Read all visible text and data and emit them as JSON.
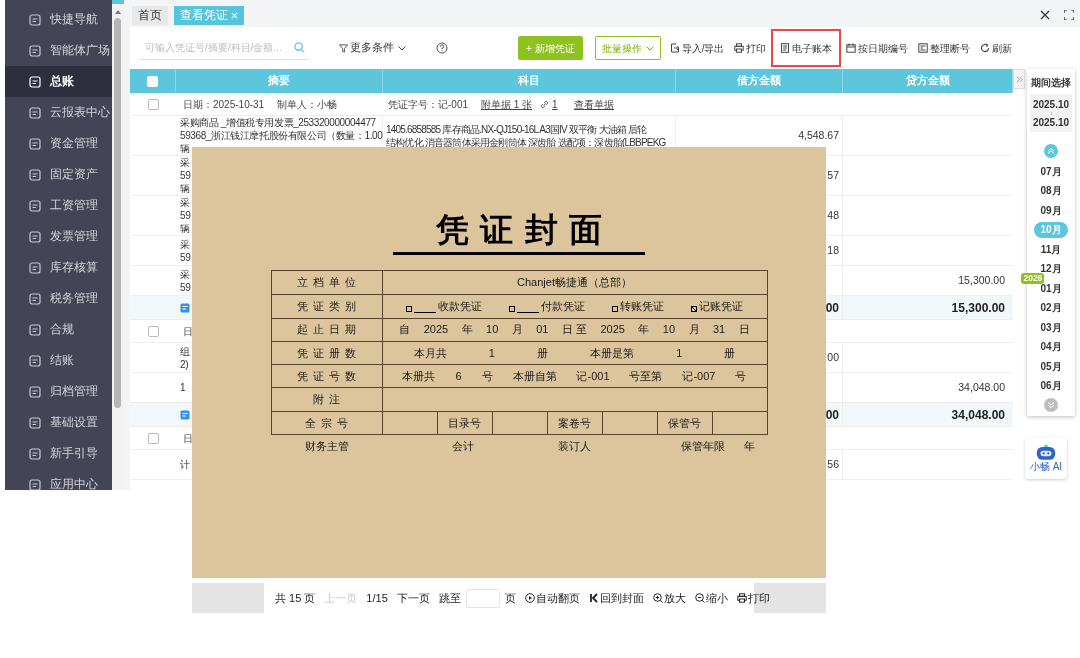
{
  "sidebar": {
    "items": [
      {
        "label": "快捷导航",
        "selected": false
      },
      {
        "label": "智能体广场",
        "selected": false
      },
      {
        "label": "总账",
        "selected": true
      },
      {
        "label": "云报表中心",
        "selected": false
      },
      {
        "label": "资金管理",
        "selected": false
      },
      {
        "label": "固定资产",
        "selected": false
      },
      {
        "label": "工资管理",
        "selected": false
      },
      {
        "label": "发票管理",
        "selected": false
      },
      {
        "label": "库存核算",
        "selected": false
      },
      {
        "label": "税务管理",
        "selected": false
      },
      {
        "label": "合规",
        "selected": false
      },
      {
        "label": "结账",
        "selected": false
      },
      {
        "label": "归档管理",
        "selected": false
      },
      {
        "label": "基础设置",
        "selected": false
      },
      {
        "label": "新手引导",
        "selected": false
      },
      {
        "label": "应用中心",
        "selected": false
      }
    ]
  },
  "tabs": [
    {
      "label": "首页",
      "selected": false,
      "closable": false
    },
    {
      "label": "查看凭证",
      "selected": true,
      "closable": true
    }
  ],
  "toolbar": {
    "search": {
      "placeholder": "可输入凭证号/摘要/科目/金额..."
    },
    "filter_label": "更多条件",
    "new_button": "+ 新增凭证",
    "batch_button": "批量操作",
    "actions": [
      {
        "kind": "import",
        "label": "导入/导出",
        "highlighted": false
      },
      {
        "kind": "print",
        "label": "打印",
        "highlighted": false
      },
      {
        "kind": "ledger",
        "label": "电子账本",
        "highlighted": true
      },
      {
        "kind": "calendar",
        "label": "按日期编号",
        "highlighted": false
      },
      {
        "kind": "sort",
        "label": "整理断号",
        "highlighted": false
      },
      {
        "kind": "refresh",
        "label": "刷新",
        "highlighted": false
      }
    ]
  },
  "table": {
    "select_all": {
      "checked": false
    },
    "columns": [
      "摘要",
      "科目",
      "借方金额",
      "贷方金额"
    ],
    "groups": [
      {
        "selected": false,
        "header": {
          "date": "日期：2025-10-31",
          "maker": "制单人：小畅",
          "number": "凭证字号：记-001",
          "attachments": "附单据 1 张",
          "links": "1",
          "view": "查看单据"
        },
        "rows": [
          {
            "kind": "entry",
            "summary": [
              "采购商品 _增值税专用发票_253320000004477",
              "59368_浙江钱江摩托股份有限公司（数量：1.00",
              "辆"
            ],
            "account": [
              "1405.6858585 库存商品.NX-QJ150-16L A3国IV 双平衡 大油箱 后轮",
              "结构优化 消音器筒体采用金刚筒体 深齿胎 选配项：深齿胎(LBBPEKG"
            ],
            "debit": "4,548.67"
          },
          {
            "kind": "entry",
            "summary": [
              "采",
              "59",
              "辆"
            ],
            "debit": "57"
          },
          {
            "kind": "entry",
            "summary": [
              "采",
              "59",
              "辆"
            ],
            "debit": "48"
          },
          {
            "kind": "entry",
            "summary": [
              "采",
              "59"
            ],
            "debit": "18"
          },
          {
            "kind": "entry",
            "summary": [
              "采",
              "59"
            ],
            "credit": "15,300.00"
          },
          {
            "kind": "total",
            "debit": "00",
            "credit": "15,300.00"
          }
        ]
      },
      {
        "selected": false,
        "header": {
          "date": "日"
        },
        "rows": [
          {
            "kind": "entry",
            "summary": [
              "组",
              "2)"
            ],
            "debit": "00"
          },
          {
            "kind": "entry",
            "summary": [
              "1"
            ],
            "credit": "34,048.00"
          },
          {
            "kind": "total",
            "debit": "00",
            "credit": "34,048.00"
          }
        ]
      },
      {
        "selected": false,
        "header": {
          "date": "日"
        },
        "rows": [
          {
            "kind": "entry",
            "summary": [
              "计"
            ],
            "debit": "56"
          }
        ]
      }
    ]
  },
  "period": {
    "title": "期间选择",
    "start": "2025.10",
    "end": "2025.10",
    "months": [
      {
        "label": "07月",
        "selected": false
      },
      {
        "label": "08月",
        "selected": false
      },
      {
        "label": "09月",
        "selected": false
      },
      {
        "label": "10月",
        "selected": true
      },
      {
        "label": "11月",
        "selected": false
      },
      {
        "label": "12月",
        "selected": false
      },
      {
        "label": "01月",
        "selected": false,
        "year": "2026"
      },
      {
        "label": "02月",
        "selected": false
      },
      {
        "label": "03月",
        "selected": false
      },
      {
        "label": "04月",
        "selected": false
      },
      {
        "label": "05月",
        "selected": false
      },
      {
        "label": "06月",
        "selected": false
      }
    ]
  },
  "assistant": {
    "label": "小畅 AI"
  },
  "cover": {
    "title": "凭证封面",
    "rows": [
      {
        "label": "立档单位",
        "kind": "text",
        "value": "Chanjet畅捷通（总部）"
      },
      {
        "label": "凭证类别",
        "kind": "types",
        "types": [
          {
            "label": "收款凭证",
            "blank": true,
            "checked": false
          },
          {
            "label": "付款凭证",
            "blank": true,
            "checked": false
          },
          {
            "label": "转账凭证",
            "blank": false,
            "checked": false
          },
          {
            "label": "记账凭证",
            "blank": false,
            "checked": true
          }
        ]
      },
      {
        "label": "起止日期",
        "kind": "tokens",
        "tokens": [
          "自",
          "2025",
          "年",
          "10",
          "月",
          "01",
          "日 至",
          "2025",
          "年",
          "10",
          "月",
          "31",
          "日"
        ]
      },
      {
        "label": "凭证册数",
        "kind": "tokens",
        "tokens": [
          "本月共",
          "1",
          "册",
          "本册是第",
          "1",
          "册"
        ]
      },
      {
        "label": "凭证号数",
        "kind": "tokens",
        "tokens": [
          "本册共",
          "6",
          "号",
          "本册自第",
          "记-001",
          "号至第",
          "记-007",
          "号"
        ]
      },
      {
        "label": "附注",
        "kind": "empty"
      },
      {
        "label": "全宗号",
        "kind": "fields",
        "fields": [
          "目录号",
          "案卷号",
          "保管号"
        ]
      }
    ],
    "signatures": [
      "财务主管",
      "会计",
      "装订人",
      "保管年限",
      "年"
    ]
  },
  "pager": {
    "total": "共 15 页",
    "prev": {
      "label": "上一页",
      "disabled": true
    },
    "page": "1/15",
    "next": {
      "label": "下一页",
      "disabled": false
    },
    "jump_label": "跳至",
    "jump_suffix": "页",
    "actions": [
      {
        "kind": "autoplay",
        "label": "自动翻页"
      },
      {
        "kind": "first",
        "label": "回到封面"
      },
      {
        "kind": "zoom_in",
        "label": "放大"
      },
      {
        "kind": "zoom_out",
        "label": "缩小"
      },
      {
        "kind": "print",
        "label": "打印"
      }
    ]
  }
}
